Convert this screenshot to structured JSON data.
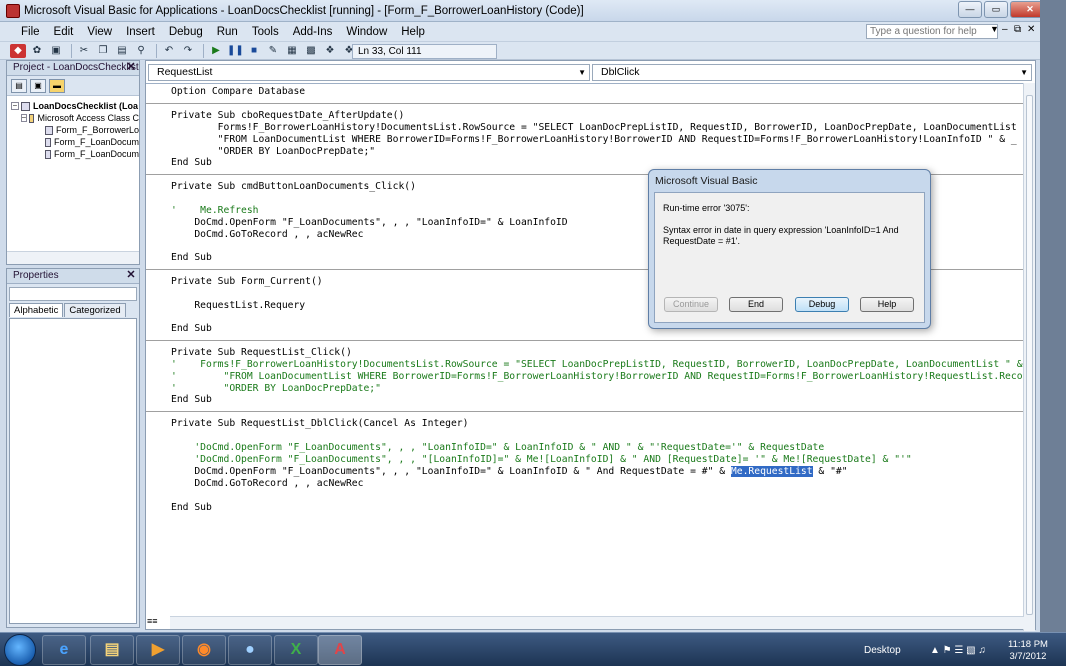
{
  "window": {
    "title": "Microsoft Visual Basic for Applications - LoanDocsChecklist [running] - [Form_F_BorrowerLoanHistory (Code)]"
  },
  "menu": {
    "items": [
      {
        "label": "File"
      },
      {
        "label": "Edit"
      },
      {
        "label": "View"
      },
      {
        "label": "Insert"
      },
      {
        "label": "Debug"
      },
      {
        "label": "Run"
      },
      {
        "label": "Tools"
      },
      {
        "label": "Add-Ins"
      },
      {
        "label": "Window"
      },
      {
        "label": "Help"
      }
    ],
    "help_placeholder": "Type a question for help"
  },
  "toolbar": {
    "position": "Ln 33, Col 111"
  },
  "project": {
    "title": "Project - LoanDocsChecklist",
    "tree": [
      {
        "label": "LoanDocsChecklist (Loa"
      },
      {
        "label": "Microsoft Access Class C"
      },
      {
        "label": "Form_F_BorrowerLo"
      },
      {
        "label": "Form_F_LoanDocum"
      },
      {
        "label": "Form_F_LoanDocum"
      }
    ]
  },
  "properties": {
    "title": "Properties",
    "tabs": [
      {
        "label": "Alphabetic"
      },
      {
        "label": "Categorized"
      }
    ]
  },
  "code": {
    "object_combo": "RequestList",
    "proc_combo": "DblClick",
    "lines": [
      {
        "text": "Option Compare Database",
        "style": "code"
      },
      {
        "text": "Private Sub cboRequestDate_AfterUpdate()",
        "style": "code"
      },
      {
        "text": "        Forms!F_BorrowerLoanHistory!DocumentsList.RowSource = \"SELECT LoanDocPrepListID, RequestID, BorrowerID, LoanDocPrepDate, LoanDocumentList \" & _",
        "style": "code"
      },
      {
        "text": "        \"FROM LoanDocumentList WHERE BorrowerID=Forms!F_BorrowerLoanHistory!BorrowerID AND RequestID=Forms!F_BorrowerLoanHistory!LoanInfoID \" & _",
        "style": "code"
      },
      {
        "text": "        \"ORDER BY LoanDocPrepDate;\"",
        "style": "code"
      },
      {
        "text": "End Sub",
        "style": "code"
      },
      {
        "text": "Private Sub cmdButtonLoanDocuments_Click()",
        "style": "code"
      },
      {
        "text": "'    Me.Refresh",
        "style": "comment"
      },
      {
        "text": "    DoCmd.OpenForm \"F_LoanDocuments\", , , \"LoanInfoID=\" & LoanInfoID",
        "style": "code"
      },
      {
        "text": "    DoCmd.GoToRecord , , acNewRec",
        "style": "code"
      },
      {
        "text": "End Sub",
        "style": "code"
      },
      {
        "text": "Private Sub Form_Current()",
        "style": "code"
      },
      {
        "text": "    RequestList.Requery",
        "style": "code"
      },
      {
        "text": "End Sub",
        "style": "code"
      },
      {
        "text": "Private Sub RequestList_Click()",
        "style": "code"
      },
      {
        "text": "'    Forms!F_BorrowerLoanHistory!DocumentsList.RowSource = \"SELECT LoanDocPrepListID, RequestID, BorrowerID, LoanDocPrepDate, LoanDocumentList \" & _",
        "style": "comment"
      },
      {
        "text": "'        \"FROM LoanDocumentList WHERE BorrowerID=Forms!F_BorrowerLoanHistory!BorrowerID AND RequestID=Forms!F_BorrowerLoanHistory!RequestList.Recor",
        "style": "comment"
      },
      {
        "text": "'        \"ORDER BY LoanDocPrepDate;\"",
        "style": "comment"
      },
      {
        "text": "End Sub",
        "style": "code"
      },
      {
        "text": "Private Sub RequestList_DblClick(Cancel As Integer)",
        "style": "code"
      },
      {
        "text": "    'DoCmd.OpenForm \"F_LoanDocuments\", , , \"LoanInfoID=\" & LoanInfoID & \" AND \" & \"'RequestDate='\" & RequestDate",
        "style": "comment"
      },
      {
        "text": "    'DoCmd.OpenForm \"F_LoanDocuments\", , , \"[LoanInfoID]=\" & Me![LoanInfoID] & \" AND [RequestDate]= '\" & Me![RequestDate] & \"'\"",
        "style": "comment"
      },
      {
        "text": "    DoCmd.OpenForm \"F_LoanDocuments\", , , \"LoanInfoID=\" & LoanInfoID & \" And RequestDate = #\" & ",
        "style": "code"
      },
      {
        "text": "Me.RequestList",
        "style": "selection"
      },
      {
        "text": " & \"#\"",
        "style": "code"
      },
      {
        "text": "    DoCmd.GoToRecord , , acNewRec",
        "style": "code"
      },
      {
        "text": "End Sub",
        "style": "code"
      }
    ]
  },
  "dialog": {
    "title": "Microsoft Visual Basic",
    "error": "Run-time error '3075':",
    "message": "Syntax error in date in query expression 'LoanInfoID=1 And RequestDate = #1'.",
    "buttons": [
      {
        "label": "Continue",
        "enabled": false
      },
      {
        "label": "End",
        "enabled": true
      },
      {
        "label": "Debug",
        "enabled": true
      },
      {
        "label": "Help",
        "enabled": true
      }
    ]
  },
  "taskbar": {
    "desktop_label": "Desktop",
    "time": "11:18 PM",
    "date": "3/7/2012",
    "apps": [
      {
        "name": "internet-explorer"
      },
      {
        "name": "file-explorer"
      },
      {
        "name": "media-player"
      },
      {
        "name": "firefox"
      },
      {
        "name": "app-5"
      },
      {
        "name": "excel"
      },
      {
        "name": "access"
      }
    ]
  },
  "colors": {
    "comment": "#1a7a1a",
    "keyword": "#00008b",
    "selection": "#316ac5"
  }
}
